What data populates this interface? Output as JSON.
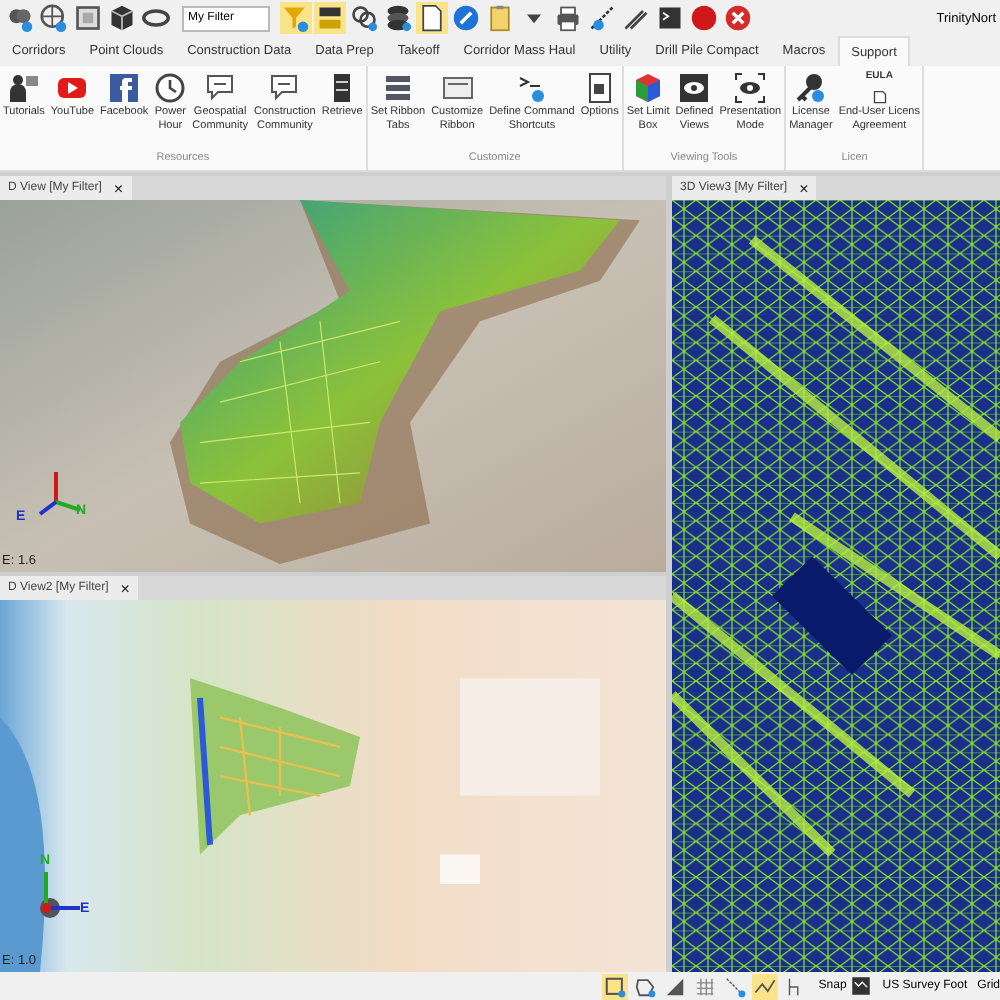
{
  "qat": {
    "filter_value": "My Filter",
    "user": "TrinityNort",
    "buttons": [
      {
        "on": false
      },
      {
        "on": false
      },
      {
        "on": false
      },
      {
        "on": false
      },
      {
        "on": false
      },
      {
        "on": true
      },
      {
        "on": true
      },
      {
        "on": false
      },
      {
        "on": false
      },
      {
        "on": true
      },
      {
        "on": false
      },
      {
        "on": false
      },
      {
        "on": false
      },
      {
        "on": false
      },
      {
        "on": false
      },
      {
        "on": false
      },
      {
        "on": false
      },
      {
        "on": false
      },
      {
        "on": false
      }
    ]
  },
  "ribbon_tabs": [
    {
      "label": "Corridors",
      "selected": false
    },
    {
      "label": "Point Clouds",
      "selected": false
    },
    {
      "label": "Construction Data",
      "selected": false
    },
    {
      "label": "Data Prep",
      "selected": false
    },
    {
      "label": "Takeoff",
      "selected": false
    },
    {
      "label": "Corridor Mass Haul",
      "selected": false
    },
    {
      "label": "Utility",
      "selected": false
    },
    {
      "label": "Drill Pile Compact",
      "selected": false
    },
    {
      "label": "Macros",
      "selected": false
    },
    {
      "label": "Support",
      "selected": true
    }
  ],
  "ribbon_groups": [
    {
      "label": "Resources",
      "items": [
        {
          "lines": [
            "Tutorials"
          ]
        },
        {
          "lines": [
            "YouTube"
          ]
        },
        {
          "lines": [
            "Facebook"
          ]
        },
        {
          "lines": [
            "Power",
            "Hour"
          ]
        },
        {
          "lines": [
            "Geospatial",
            "Community"
          ]
        },
        {
          "lines": [
            "Construction",
            "Community"
          ]
        },
        {
          "lines": [
            "Retrieve"
          ]
        }
      ]
    },
    {
      "label": "Customize",
      "items": [
        {
          "lines": [
            "Set Ribbon",
            "Tabs"
          ]
        },
        {
          "lines": [
            "Customize",
            "Ribbon"
          ]
        },
        {
          "lines": [
            "Define Command",
            "Shortcuts"
          ]
        },
        {
          "lines": [
            "Options"
          ]
        }
      ]
    },
    {
      "label": "Viewing Tools",
      "items": [
        {
          "lines": [
            "Set Limit",
            "Box"
          ]
        },
        {
          "lines": [
            "Defined",
            "Views"
          ]
        },
        {
          "lines": [
            "Presentation",
            "Mode"
          ]
        }
      ]
    },
    {
      "label": "Licen",
      "items": [
        {
          "lines": [
            "License",
            "Manager"
          ]
        },
        {
          "lines": [
            "End-User Licens",
            "Agreement"
          ],
          "badge": "EULA"
        }
      ]
    }
  ],
  "left_views": [
    {
      "title": "D View [My Filter]",
      "close": "×",
      "kind": "model",
      "scale": "E: 1.6",
      "axis": {
        "kind": "iso",
        "labels": [
          {
            "text": "E",
            "color": "#2233cc"
          },
          {
            "text": "N",
            "color": "#22aa22"
          }
        ]
      }
    },
    {
      "title": "D View2 [My Filter]",
      "close": "×",
      "kind": "aerial",
      "scale": "E: 1.0",
      "axis": {
        "kind": "plan",
        "labels": [
          {
            "text": "N",
            "color": "#22aa22"
          },
          {
            "text": "E",
            "color": "#2233cc"
          }
        ]
      }
    }
  ],
  "right_view": {
    "title": "3D View3 [My Filter]",
    "close": "×",
    "kind": "wireframe"
  },
  "status_bar": {
    "toggles": [
      {
        "on": true
      },
      {
        "on": false
      },
      {
        "on": false
      },
      {
        "on": false
      },
      {
        "on": false
      },
      {
        "on": true
      },
      {
        "on": false
      }
    ],
    "snap": "Snap",
    "units": "US Survey Foot",
    "grid": "Grid"
  }
}
